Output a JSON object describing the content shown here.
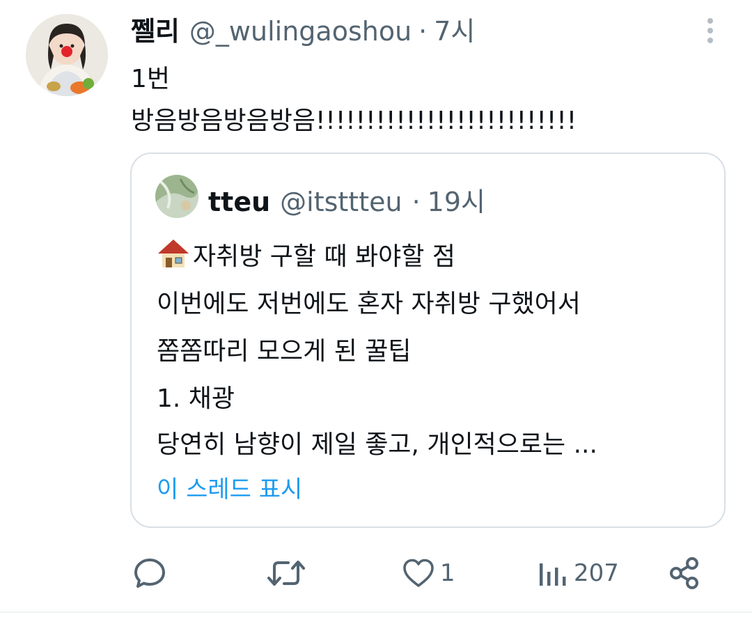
{
  "tweet": {
    "author_name": "쩰리",
    "author_handle": "@_wulingaoshou",
    "separator": "·",
    "time": "7시",
    "text_lines": [
      "1번",
      "방음방음방음방음!!!!!!!!!!!!!!!!!!!!!!!!!!"
    ]
  },
  "quoted": {
    "author_name": "tteu",
    "author_handle": "@itsttteu",
    "separator": "·",
    "time": "19시",
    "lines": [
      "자취방 구할 때 봐야할 점",
      "이번에도 저번에도 혼자 자취방 구했어서",
      "쫌쫌따리 모으게 된 꿀팁",
      "1. 채광",
      "당연히 남향이 제일 좋고, 개인적으로는 ..."
    ],
    "first_line_icon": "house-icon",
    "show_thread": "이 스레드 표시"
  },
  "actions": {
    "reply_icon": "reply-icon",
    "retweet_icon": "retweet-icon",
    "like_icon": "heart-icon",
    "like_count": "1",
    "views_icon": "views-icon",
    "views_count": "207",
    "share_icon": "share-icon"
  },
  "colors": {
    "text": "#0f1419",
    "secondary": "#536471",
    "link": "#1d9bf0",
    "border": "#d9dfe4"
  }
}
